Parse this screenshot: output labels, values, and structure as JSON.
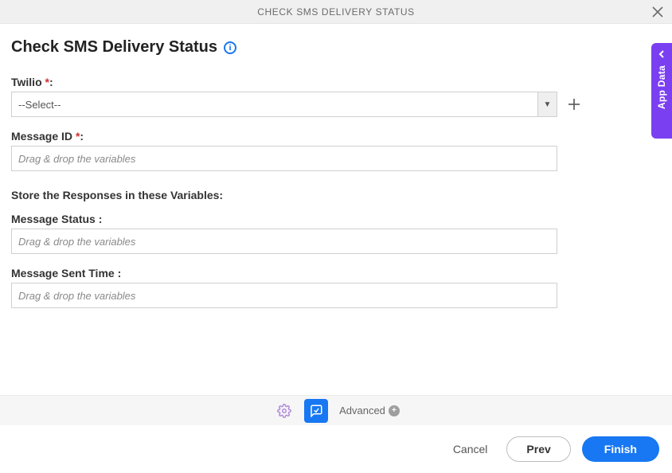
{
  "header": {
    "title": "CHECK SMS DELIVERY STATUS"
  },
  "page": {
    "title": "Check SMS Delivery Status",
    "info_glyph": "i"
  },
  "fields": {
    "twilio": {
      "label": "Twilio",
      "required": "*",
      "colon": ":",
      "selected": "--Select--"
    },
    "message_id": {
      "label": "Message ID",
      "required": "*",
      "colon": ":",
      "placeholder": "Drag & drop the variables"
    },
    "responses_heading": "Store the Responses in these Variables:",
    "message_status": {
      "label": "Message Status :",
      "placeholder": "Drag & drop the variables"
    },
    "message_sent_time": {
      "label": "Message Sent Time :",
      "placeholder": "Drag & drop the variables"
    }
  },
  "toolbar": {
    "advanced_label": "Advanced"
  },
  "footer": {
    "cancel": "Cancel",
    "prev": "Prev",
    "finish": "Finish"
  },
  "side_tab": {
    "label": "App Data"
  }
}
